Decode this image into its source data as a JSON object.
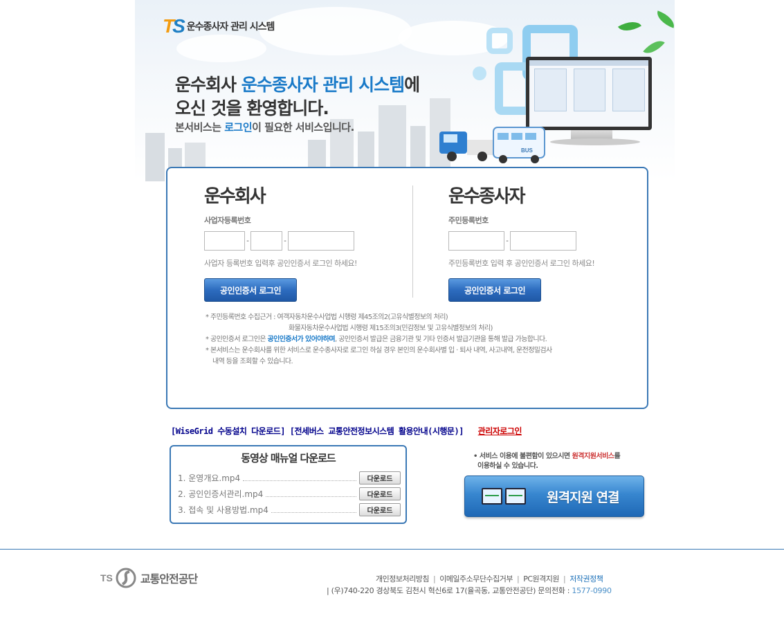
{
  "header": {
    "logo_letters_t": "T",
    "logo_letters_s": "S",
    "logo_title": "운수종사자 관리 시스템",
    "welcome_prefix": "운수회사 ",
    "welcome_highlight": "운수종사자 관리 시스템",
    "welcome_suffix": "에",
    "welcome_line2": "오신 것을 환영합니다.",
    "service_prefix": "본서비스는 ",
    "service_highlight": "로그인",
    "service_suffix": "이 필요한 서비스입니다.",
    "bus_label": "BUS"
  },
  "company": {
    "title": "운수회사",
    "field_label": "사업자등록번호",
    "input1_value": "",
    "input2_value": "",
    "input3_value": "",
    "hint": "사업자 등록번호 입력후 공인인증서 로그인 하세요!",
    "button": "공인인증서 로그인"
  },
  "driver": {
    "title": "운수종사자",
    "field_label": "주민등록번호",
    "input1_value": "",
    "input2_value": "",
    "hint": "주민등록번호 입력 후 공인인증서 로그인 하세요!",
    "button": "공인인증서 로그인"
  },
  "notes": {
    "line1": "* 주민등록번호 수집근거 : 여객자동차운수사업법 시행령 제45조의2(고유식별정보의 처리)",
    "line2": "화물자동차운수사업법 시행령 제15조의3(민감정보 및 고유식별정보의 처리)",
    "line3_prefix": "* 공인인증서 로그인은 ",
    "line3_strong": "공인인증서가 있어야하며",
    "line3_suffix": ", 공인인증서 발급은 금융기관 및 기타 인증서 발급기관을 통해 발급 가능합니다.",
    "line4": "* 본서비스는 운수회사를 위한 서비스로 운수종사자로 로그인 하실 경우 본인의 운수회사별 입 · 퇴사 내역, 사고내역, 운전정밀검사",
    "line5": "내역 등을 조회할 수 있습니다."
  },
  "links": {
    "wisegrid": "[WiseGrid 수동설치 다운로드]",
    "guide": "[전세버스 교통안전정보시스템 활용안내(시행문)]",
    "admin": "관리자로그인"
  },
  "video": {
    "title": "동영상 매뉴얼 다운로드",
    "items": [
      {
        "name": "1. 운영개요.mp4",
        "button": "다운로드"
      },
      {
        "name": "2. 공인인증서관리.mp4",
        "button": "다운로드"
      },
      {
        "name": "3. 접속 및 사용방법.mp4",
        "button": "다운로드"
      }
    ]
  },
  "remote": {
    "note_prefix": "• 서비스 이용에 불편함이 있으시면 ",
    "note_highlight": "원격지원서비스",
    "note_suffix": "를",
    "note_line2": "이용하실 수 있습니다.",
    "button": "원격지원 연결"
  },
  "footer": {
    "logo_ts": "TS",
    "logo_name": "교통안전공단",
    "links": [
      "개인정보처리방침",
      "이메일주소무단수집거부",
      "PC원격지원",
      "저작권정책"
    ],
    "address": "| (우)740-220 경상북도 김천시 혁신6로 17(율곡동, 교통안전공단) 문의전화 : ",
    "phone": "1577-0990"
  },
  "colors": {
    "accent_blue": "#1a7ac8",
    "border_blue": "#3a78b5",
    "admin_red": "#cc0000",
    "link_navy": "#00008b"
  }
}
